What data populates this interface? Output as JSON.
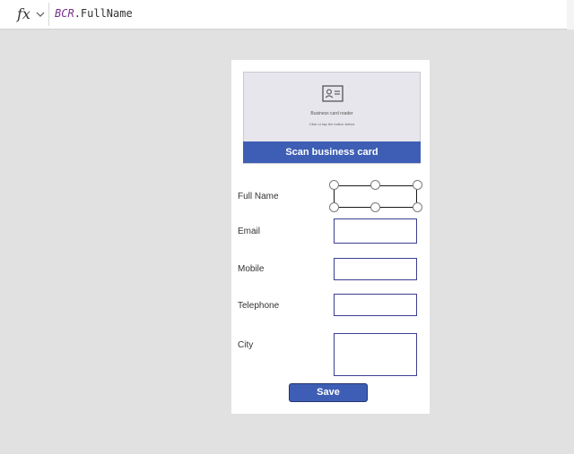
{
  "formula_bar": {
    "fx_label": "fx",
    "control_name": "BCR",
    "property_suffix": ".FullName"
  },
  "business_card_reader": {
    "title": "Business card reader",
    "hint": "Click or tap the button below",
    "scan_label": "Scan business card"
  },
  "form": {
    "fields": [
      {
        "label": "Full Name",
        "value": ""
      },
      {
        "label": "Email",
        "value": ""
      },
      {
        "label": "Mobile",
        "value": ""
      },
      {
        "label": "Telephone",
        "value": ""
      },
      {
        "label": "City",
        "value": ""
      }
    ],
    "save_label": "Save"
  },
  "colors": {
    "canvas_background": "#e1e1e1",
    "accent": "#3d5eb4",
    "input_border": "#3b3f8f",
    "formula_keyword": "#7a2f8e"
  },
  "icons": {
    "formula": "fx-icon",
    "formula_dropdown": "chevron-down-icon",
    "card": "contact-card-icon"
  }
}
